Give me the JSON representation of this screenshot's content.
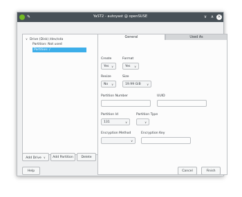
{
  "window": {
    "title": "YaST2 - autoyast @ openSUSE",
    "pin_glyph": "✎",
    "minimize_glyph": "∨",
    "maximize_glyph": "∧",
    "close_glyph": "×"
  },
  "tree": {
    "arrow_glyph": "∨",
    "root": "Drive (Disk) /dev/sda",
    "children": [
      "Partition: Not used",
      "Partition: /"
    ]
  },
  "tabs": [
    "General",
    "Used As"
  ],
  "form": {
    "create_label": "Create",
    "create_value": "Yes",
    "format_label": "Format",
    "format_value": "Yes",
    "resize_label": "Resize",
    "resize_value": "No",
    "size_label": "Size",
    "size_value": "19.99 GiB",
    "partition_number_label": "Partition Number",
    "uuid_label": "UUID",
    "partition_id_label": "Partition Id",
    "partition_id_value": "131",
    "partition_type_label": "Partition Type",
    "encryption_method_label": "Encryption Method",
    "encryption_key_label": "Encryption Key",
    "caret_glyph": "∨"
  },
  "buttons": {
    "add_drive": "Add Drive",
    "add_partition": "Add Partition",
    "delete": "Delete",
    "help": "Help",
    "cancel": "Cancel",
    "finish": "Finish"
  },
  "colors": {
    "titlebar": "#475057",
    "selection": "#3daee9",
    "app_icon": "#73ba25"
  }
}
